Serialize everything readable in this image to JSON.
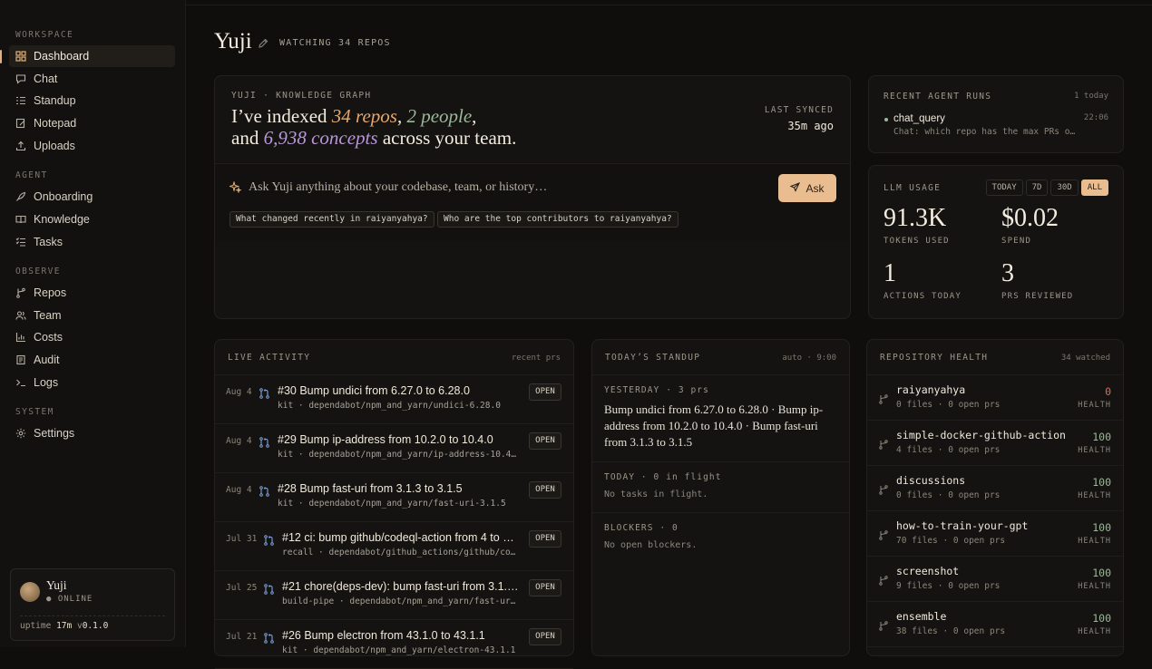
{
  "sidebar": {
    "sections": {
      "workspace": "WORKSPACE",
      "agent": "AGENT",
      "observe": "OBSERVE",
      "system": "SYSTEM"
    },
    "items": [
      {
        "label": "Dashboard",
        "icon": "grid-icon"
      },
      {
        "label": "Chat",
        "icon": "chat-icon"
      },
      {
        "label": "Standup",
        "icon": "list-icon"
      },
      {
        "label": "Notepad",
        "icon": "notepad-icon"
      },
      {
        "label": "Uploads",
        "icon": "upload-icon"
      },
      {
        "label": "Onboarding",
        "icon": "rocket-icon"
      },
      {
        "label": "Knowledge",
        "icon": "book-icon"
      },
      {
        "label": "Tasks",
        "icon": "tasks-icon"
      },
      {
        "label": "Repos",
        "icon": "branch-icon"
      },
      {
        "label": "Team",
        "icon": "people-icon"
      },
      {
        "label": "Costs",
        "icon": "bar-chart-icon"
      },
      {
        "label": "Audit",
        "icon": "audit-icon"
      },
      {
        "label": "Logs",
        "icon": "terminal-icon"
      },
      {
        "label": "Settings",
        "icon": "gear-icon"
      }
    ],
    "user": {
      "name": "Yuji",
      "status": "● ONLINE",
      "uptime_label": "uptime",
      "uptime_value": "17m",
      "version_prefix": "v",
      "version": "0.1.0"
    }
  },
  "header": {
    "title": "Yuji",
    "watching": "WATCHING 34 REPOS"
  },
  "knowledge": {
    "label": "YUJI · KNOWLEDGE GRAPH",
    "line1_a": "I’ve indexed ",
    "repos": "34 repos",
    "sep1": ", ",
    "people": "2 people",
    "sep2": ",",
    "line2_a": "and ",
    "concepts": "6,938 concepts",
    "line2_b": " across your team.",
    "synced_label": "LAST SYNCED",
    "synced_value": "35m ago",
    "ask_placeholder": "Ask Yuji anything about your codebase, team, or history…",
    "ask_button": "Ask",
    "chips": [
      "What changed recently in raiyanyahya?",
      "Who are the top contributors to raiyanyahya?"
    ]
  },
  "runs": {
    "label": "RECENT AGENT RUNS",
    "count": "1 today",
    "items": [
      {
        "name": "chat_query",
        "time": "22:06",
        "desc": "Chat: which repo has the max PRs open…"
      }
    ]
  },
  "llm": {
    "label": "LLM USAGE",
    "tabs": [
      "TODAY",
      "7D",
      "30D",
      "ALL"
    ],
    "active_tab": "ALL",
    "metrics": [
      {
        "value": "91.3K",
        "label": "TOKENS USED"
      },
      {
        "value": "$0.02",
        "label": "SPEND"
      },
      {
        "value": "1",
        "label": "ACTIONS TODAY"
      },
      {
        "value": "3",
        "label": "PRS REVIEWED"
      }
    ]
  },
  "live": {
    "label": "LIVE ACTIVITY",
    "side": "recent prs",
    "badge": "OPEN",
    "prs": [
      {
        "date": "Aug 4",
        "title": "#30 Bump undici from 6.27.0 to 6.28.0",
        "sub": "kit · dependabot/npm_and_yarn/undici-6.28.0"
      },
      {
        "date": "Aug 4",
        "title": "#29 Bump ip-address from 10.2.0 to 10.4.0",
        "sub": "kit · dependabot/npm_and_yarn/ip-address-10.4…"
      },
      {
        "date": "Aug 4",
        "title": "#28 Bump fast-uri from 3.1.3 to 3.1.5",
        "sub": "kit · dependabot/npm_and_yarn/fast-uri-3.1.5"
      },
      {
        "date": "Jul 31",
        "title": "#12 ci: bump github/codeql-action from 4 to 4.…",
        "sub": "recall · dependabot/github_actions/github/co…"
      },
      {
        "date": "Jul 25",
        "title": "#21 chore(deps-dev): bump fast-uri from 3.1.2 t…",
        "sub": "build-pipe · dependabot/npm_and_yarn/fast-ur…"
      },
      {
        "date": "Jul 21",
        "title": "#26 Bump electron from 43.1.0 to 43.1.1",
        "sub": "kit · dependabot/npm_and_yarn/electron-43.1.1"
      }
    ]
  },
  "standup": {
    "label": "TODAY’S STANDUP",
    "side": "auto · 9:00",
    "yesterday_label": "YESTERDAY · 3 prs",
    "yesterday_body": "Bump undici from 6.27.0 to 6.28.0 · Bump ip-address from 10.2.0 to 10.4.0 · Bump fast-uri from 3.1.3 to 3.1.5",
    "today_label": "TODAY · 0 in flight",
    "today_body": "No tasks in flight.",
    "blockers_label": "BLOCKERS · 0",
    "blockers_body": "No open blockers."
  },
  "health": {
    "label": "REPOSITORY HEALTH",
    "side": "34 watched",
    "health_label": "HEALTH",
    "repos": [
      {
        "name": "raiyanyahya",
        "meta": "0 files · 0 open prs",
        "score": "0"
      },
      {
        "name": "simple-docker-github-action",
        "meta": "4 files · 0 open prs",
        "score": "100"
      },
      {
        "name": "discussions",
        "meta": "0 files · 0 open prs",
        "score": "100"
      },
      {
        "name": "how-to-train-your-gpt",
        "meta": "70 files · 0 open prs",
        "score": "100"
      },
      {
        "name": "screenshot",
        "meta": "9 files · 0 open prs",
        "score": "100"
      },
      {
        "name": "ensemble",
        "meta": "38 files · 0 open prs",
        "score": "100"
      }
    ]
  },
  "colors": {
    "accent": "#e9bd8f",
    "repos_highlight": "#e6a86c",
    "people_highlight": "#9cb89a",
    "concepts_highlight": "#b896d8",
    "health_good": "#9cb89a",
    "health_bad": "#e06a5a"
  }
}
